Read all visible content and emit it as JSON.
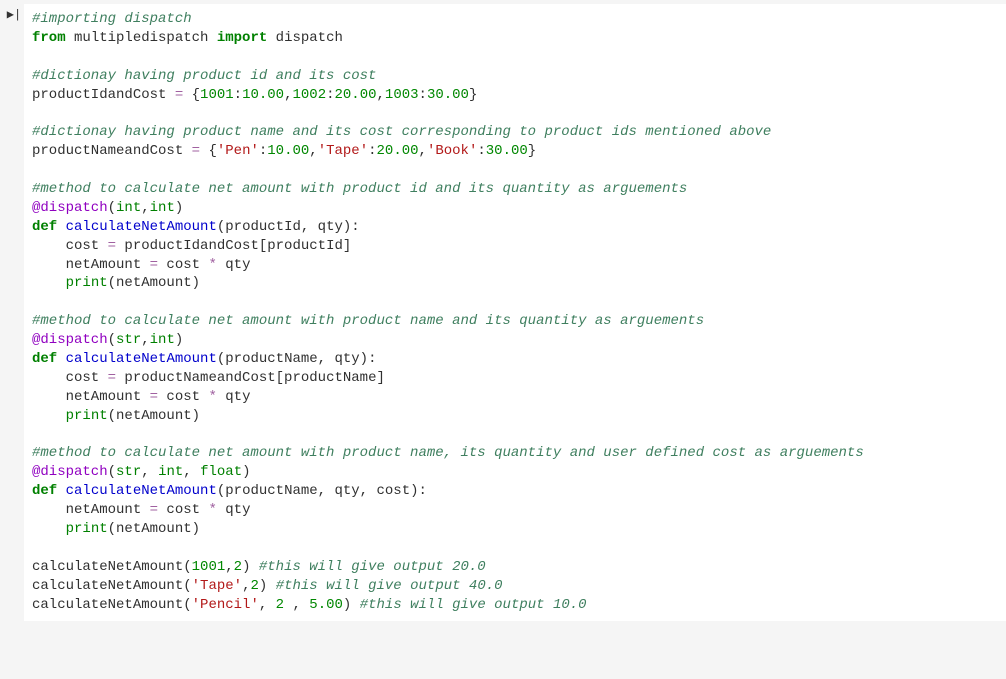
{
  "cell": {
    "indicator": "▶|",
    "lines": [
      [
        {
          "t": "#importing dispatch",
          "cls": "c"
        }
      ],
      [
        {
          "t": "from",
          "cls": "kw"
        },
        {
          "t": " multipledispatch ",
          "cls": "pl"
        },
        {
          "t": "import",
          "cls": "kw"
        },
        {
          "t": " dispatch",
          "cls": "pl"
        }
      ],
      [],
      [
        {
          "t": "#dictionay having product id and its cost",
          "cls": "c"
        }
      ],
      [
        {
          "t": "productIdandCost ",
          "cls": "pl"
        },
        {
          "t": "=",
          "cls": "op"
        },
        {
          "t": " {",
          "cls": "pl"
        },
        {
          "t": "1001",
          "cls": "nm"
        },
        {
          "t": ":",
          "cls": "pl"
        },
        {
          "t": "10.00",
          "cls": "nm"
        },
        {
          "t": ",",
          "cls": "pl"
        },
        {
          "t": "1002",
          "cls": "nm"
        },
        {
          "t": ":",
          "cls": "pl"
        },
        {
          "t": "20.00",
          "cls": "nm"
        },
        {
          "t": ",",
          "cls": "pl"
        },
        {
          "t": "1003",
          "cls": "nm"
        },
        {
          "t": ":",
          "cls": "pl"
        },
        {
          "t": "30.00",
          "cls": "nm"
        },
        {
          "t": "}",
          "cls": "pl"
        }
      ],
      [],
      [
        {
          "t": "#dictionay having product name and its cost corresponding to product ids mentioned above",
          "cls": "c"
        }
      ],
      [
        {
          "t": "productNameandCost ",
          "cls": "pl"
        },
        {
          "t": "=",
          "cls": "op"
        },
        {
          "t": " {",
          "cls": "pl"
        },
        {
          "t": "'Pen'",
          "cls": "st"
        },
        {
          "t": ":",
          "cls": "pl"
        },
        {
          "t": "10.00",
          "cls": "nm"
        },
        {
          "t": ",",
          "cls": "pl"
        },
        {
          "t": "'Tape'",
          "cls": "st"
        },
        {
          "t": ":",
          "cls": "pl"
        },
        {
          "t": "20.00",
          "cls": "nm"
        },
        {
          "t": ",",
          "cls": "pl"
        },
        {
          "t": "'Book'",
          "cls": "st"
        },
        {
          "t": ":",
          "cls": "pl"
        },
        {
          "t": "30.00",
          "cls": "nm"
        },
        {
          "t": "}",
          "cls": "pl"
        }
      ],
      [],
      [
        {
          "t": "#method to calculate net amount with product id and its quantity as arguements",
          "cls": "c"
        }
      ],
      [
        {
          "t": "@dispatch",
          "cls": "dec"
        },
        {
          "t": "(",
          "cls": "pl"
        },
        {
          "t": "int",
          "cls": "bi"
        },
        {
          "t": ",",
          "cls": "pl"
        },
        {
          "t": "int",
          "cls": "bi"
        },
        {
          "t": ")",
          "cls": "pl"
        }
      ],
      [
        {
          "t": "def",
          "cls": "kw"
        },
        {
          "t": " ",
          "cls": "pl"
        },
        {
          "t": "calculateNetAmount",
          "cls": "fn"
        },
        {
          "t": "(productId, qty):",
          "cls": "pl"
        }
      ],
      [
        {
          "t": "    cost ",
          "cls": "pl"
        },
        {
          "t": "=",
          "cls": "op"
        },
        {
          "t": " productIdandCost[productId]",
          "cls": "pl"
        }
      ],
      [
        {
          "t": "    netAmount ",
          "cls": "pl"
        },
        {
          "t": "=",
          "cls": "op"
        },
        {
          "t": " cost ",
          "cls": "pl"
        },
        {
          "t": "*",
          "cls": "op"
        },
        {
          "t": " qty",
          "cls": "pl"
        }
      ],
      [
        {
          "t": "    ",
          "cls": "pl"
        },
        {
          "t": "print",
          "cls": "bi"
        },
        {
          "t": "(netAmount)",
          "cls": "pl"
        }
      ],
      [],
      [
        {
          "t": "#method to calculate net amount with product name and its quantity as arguements",
          "cls": "c"
        }
      ],
      [
        {
          "t": "@dispatch",
          "cls": "dec"
        },
        {
          "t": "(",
          "cls": "pl"
        },
        {
          "t": "str",
          "cls": "bi"
        },
        {
          "t": ",",
          "cls": "pl"
        },
        {
          "t": "int",
          "cls": "bi"
        },
        {
          "t": ")",
          "cls": "pl"
        }
      ],
      [
        {
          "t": "def",
          "cls": "kw"
        },
        {
          "t": " ",
          "cls": "pl"
        },
        {
          "t": "calculateNetAmount",
          "cls": "fn"
        },
        {
          "t": "(productName, qty):",
          "cls": "pl"
        }
      ],
      [
        {
          "t": "    cost ",
          "cls": "pl"
        },
        {
          "t": "=",
          "cls": "op"
        },
        {
          "t": " productNameandCost[productName]",
          "cls": "pl"
        }
      ],
      [
        {
          "t": "    netAmount ",
          "cls": "pl"
        },
        {
          "t": "=",
          "cls": "op"
        },
        {
          "t": " cost ",
          "cls": "pl"
        },
        {
          "t": "*",
          "cls": "op"
        },
        {
          "t": " qty",
          "cls": "pl"
        }
      ],
      [
        {
          "t": "    ",
          "cls": "pl"
        },
        {
          "t": "print",
          "cls": "bi"
        },
        {
          "t": "(netAmount)",
          "cls": "pl"
        }
      ],
      [],
      [
        {
          "t": "#method to calculate net amount with product name, its quantity and user defined cost as arguements",
          "cls": "c"
        }
      ],
      [
        {
          "t": "@dispatch",
          "cls": "dec"
        },
        {
          "t": "(",
          "cls": "pl"
        },
        {
          "t": "str",
          "cls": "bi"
        },
        {
          "t": ", ",
          "cls": "pl"
        },
        {
          "t": "int",
          "cls": "bi"
        },
        {
          "t": ", ",
          "cls": "pl"
        },
        {
          "t": "float",
          "cls": "bi"
        },
        {
          "t": ")",
          "cls": "pl"
        }
      ],
      [
        {
          "t": "def",
          "cls": "kw"
        },
        {
          "t": " ",
          "cls": "pl"
        },
        {
          "t": "calculateNetAmount",
          "cls": "fn"
        },
        {
          "t": "(productName, qty, cost):",
          "cls": "pl"
        }
      ],
      [
        {
          "t": "    netAmount ",
          "cls": "pl"
        },
        {
          "t": "=",
          "cls": "op"
        },
        {
          "t": " cost ",
          "cls": "pl"
        },
        {
          "t": "*",
          "cls": "op"
        },
        {
          "t": " qty",
          "cls": "pl"
        }
      ],
      [
        {
          "t": "    ",
          "cls": "pl"
        },
        {
          "t": "print",
          "cls": "bi"
        },
        {
          "t": "(netAmount)",
          "cls": "pl"
        }
      ],
      [],
      [
        {
          "t": "calculateNetAmount(",
          "cls": "pl"
        },
        {
          "t": "1001",
          "cls": "nm"
        },
        {
          "t": ",",
          "cls": "pl"
        },
        {
          "t": "2",
          "cls": "nm"
        },
        {
          "t": ") ",
          "cls": "pl"
        },
        {
          "t": "#this will give output 20.0",
          "cls": "c"
        }
      ],
      [
        {
          "t": "calculateNetAmount(",
          "cls": "pl"
        },
        {
          "t": "'Tape'",
          "cls": "st"
        },
        {
          "t": ",",
          "cls": "pl"
        },
        {
          "t": "2",
          "cls": "nm"
        },
        {
          "t": ") ",
          "cls": "pl"
        },
        {
          "t": "#this will give output 40.0",
          "cls": "c"
        }
      ],
      [
        {
          "t": "calculateNetAmount(",
          "cls": "pl"
        },
        {
          "t": "'Pencil'",
          "cls": "st"
        },
        {
          "t": ", ",
          "cls": "pl"
        },
        {
          "t": "2",
          "cls": "nm"
        },
        {
          "t": " , ",
          "cls": "pl"
        },
        {
          "t": "5.00",
          "cls": "nm"
        },
        {
          "t": ") ",
          "cls": "pl"
        },
        {
          "t": "#this will give output 10.0",
          "cls": "c"
        }
      ]
    ]
  }
}
